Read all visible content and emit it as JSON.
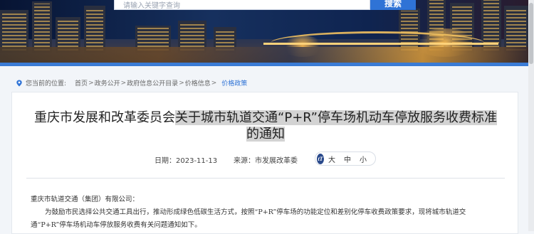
{
  "header": {
    "search_placeholder": "请输入关键字查询",
    "search_button": "搜索"
  },
  "breadcrumb": {
    "label": "您当前的位置:",
    "items": [
      "首页",
      "政务公开",
      "政府信息公开目录",
      "价格信息"
    ],
    "current": "价格政策"
  },
  "article": {
    "title_part1": "重庆市发展和改革委员会",
    "title_part2": "关于城市轨道交通“P+R”停车场机动车停放服务收费标准",
    "title_line2": "的通知",
    "date": "日期：2023-11-13",
    "source": "来源：市发展改革委",
    "fontsize": {
      "icon": "tT",
      "large": "大",
      "medium": "中",
      "small": "小"
    },
    "recipient": "重庆市轨道交通（集团）有限公司：",
    "para1_line1": "为鼓励市民选择公共交通工具出行，推动形成绿色低碳生活方式，按照“P+R”停车场的功能定位和差别化停车收费政策要求，现将城市轨道交",
    "para1_line2": "通“P+R”停车场机动车停放服务收费有关问题通知如下。"
  },
  "colors": {
    "accent": "#2f73d6",
    "highlight": "#d3d3d3"
  }
}
